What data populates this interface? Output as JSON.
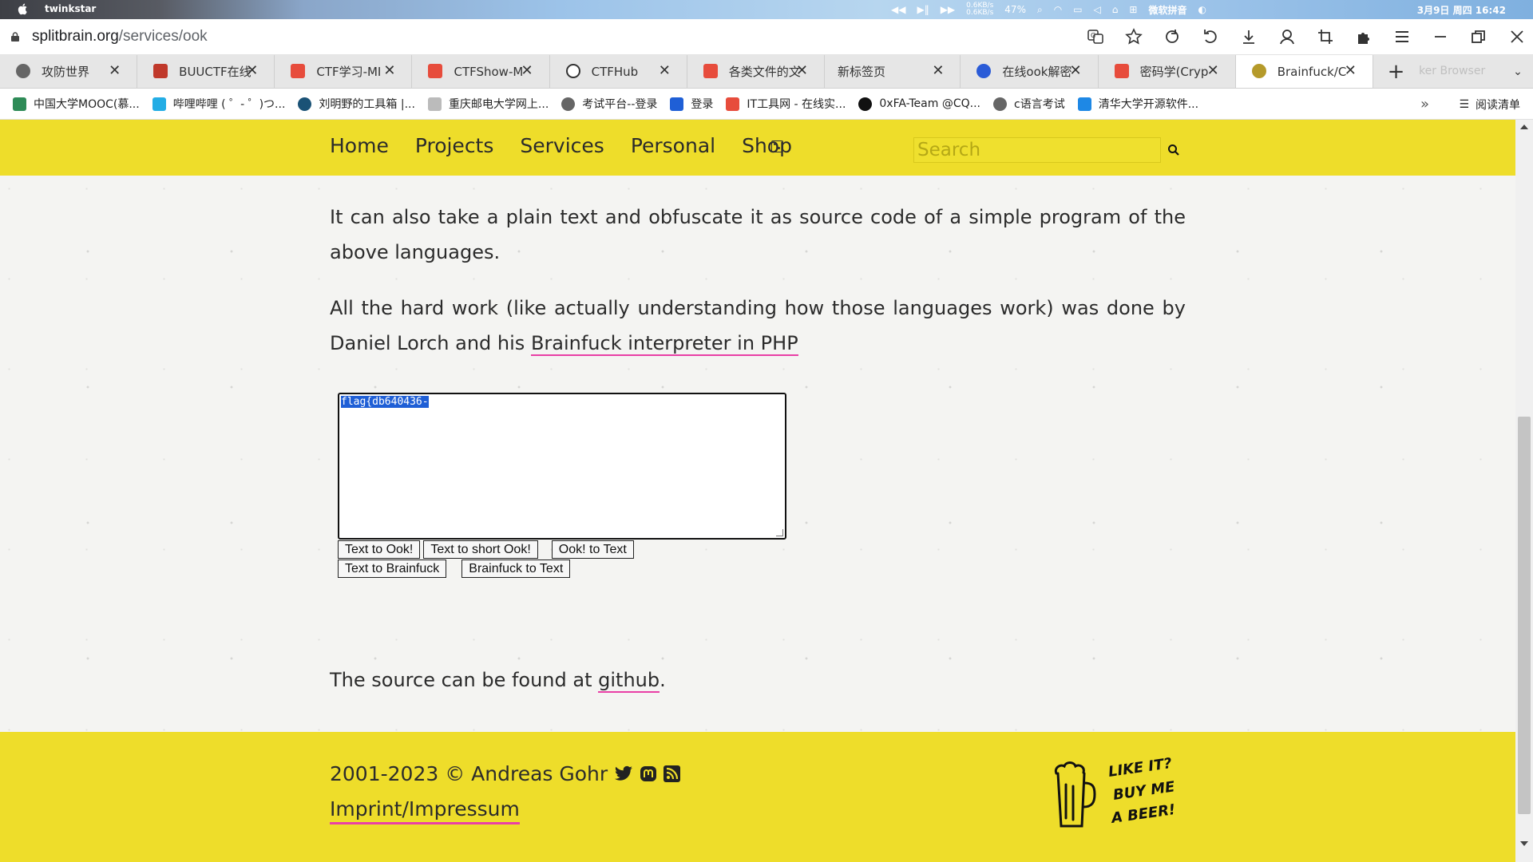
{
  "menubar": {
    "user": "twinkstar",
    "net_up": "0.6KB/s",
    "net_down": "0.6KB/s",
    "battery": "47%",
    "ime": "微软拼音",
    "clock": "3月9日 周四 16:42"
  },
  "address": {
    "host": "splitbrain.org",
    "path": "/services/ook"
  },
  "tabs": [
    {
      "title": "攻防世界",
      "favicon_color": "#555555"
    },
    {
      "title": "BUUCTF在线",
      "favicon_color": "#c0392b"
    },
    {
      "title": "CTF学习-MI",
      "favicon_color": "#e74c3c"
    },
    {
      "title": "CTFShow-M",
      "favicon_color": "#e74c3c"
    },
    {
      "title": "CTFHub",
      "favicon_color": "#333333"
    },
    {
      "title": "各类文件的文",
      "favicon_color": "#e74c3c"
    },
    {
      "title": "新标签页",
      "favicon_color": "#ffffff"
    },
    {
      "title": "在线ook解密",
      "favicon_color": "#2a5bd7"
    },
    {
      "title": "密码学(Cryp",
      "favicon_color": "#e74c3c"
    },
    {
      "title": "Brainfuck/C",
      "favicon_color": "#b59a2a",
      "active": true
    }
  ],
  "tab_ghost": "ker Browser",
  "bookmarks": [
    {
      "label": "中国大学MOOC(慕...",
      "color": "#2e8b57"
    },
    {
      "label": "哔哩哔哩 ( ゜- ゜)つ...",
      "color": "#23ade5"
    },
    {
      "label": "刘明野的工具箱 |...",
      "color": "#1a5276"
    },
    {
      "label": "重庆邮电大学网上...",
      "color": "#999999"
    },
    {
      "label": "考试平台--登录",
      "color": "#666666"
    },
    {
      "label": "登录",
      "color": "#1f5fd6"
    },
    {
      "label": "IT工具网 - 在线实...",
      "color": "#e74c3c"
    },
    {
      "label": "0xFA-Team @CQ...",
      "color": "#111111"
    },
    {
      "label": "c语言考试",
      "color": "#666666"
    },
    {
      "label": "清华大学开源软件...",
      "color": "#1e88e5"
    }
  ],
  "reading_list": "阅读清单",
  "nav": {
    "links": [
      "Home",
      "Projects",
      "Services",
      "Personal",
      "Shop"
    ],
    "search_placeholder": "Search"
  },
  "content": {
    "p1": "It can also take a plain text and obfuscate it as source code of a simple program of the above languages.",
    "p2_prefix": "All the hard work (like actually understanding how those languages work) was done by Daniel Lorch and his ",
    "p2_link": "Brainfuck interpreter in PHP",
    "textarea_value": "flag{db640436-",
    "buttons_row1": [
      "Text to Ook!",
      "Text to short Ook!",
      "Ook! to Text"
    ],
    "buttons_row2": [
      "Text to Brainfuck",
      "Brainfuck to Text"
    ],
    "source_prefix": "The source can be found at ",
    "source_link": "github",
    "source_suffix": "."
  },
  "footer": {
    "copyright": "2001-2023 © Andreas Gohr",
    "imprint": "Imprint/Impressum",
    "beer_text": [
      "LIKE IT?",
      "BUY ME",
      "A BEER!"
    ]
  },
  "colors": {
    "brand_yellow": "#eedd2a",
    "link_underline": "#e93fa6",
    "selection": "#1f5fd6"
  }
}
